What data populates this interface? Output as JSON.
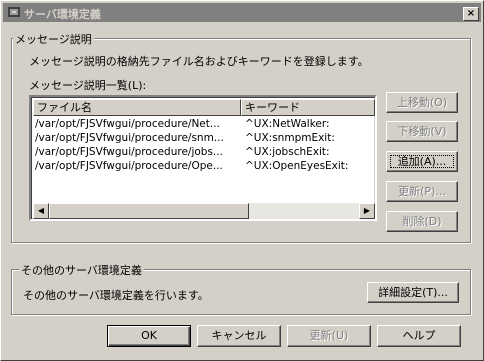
{
  "window": {
    "title": "サーバ環境定義",
    "close_glyph": "×"
  },
  "message_group": {
    "label": "メッセージ説明",
    "description": "メッセージ説明の格納先ファイル名およびキーワードを登録します。",
    "list_label": "メッセージ説明一覧(L):",
    "columns": [
      "ファイル名",
      "キーワード"
    ],
    "rows": [
      {
        "file": "/var/opt/FJSVfwgui/procedure/Net...",
        "keyword": "^UX:NetWalker:"
      },
      {
        "file": "/var/opt/FJSVfwgui/procedure/snm...",
        "keyword": "^UX:snmpmExit:"
      },
      {
        "file": "/var/opt/FJSVfwgui/procedure/jobs...",
        "keyword": "^UX:jobschExit:"
      },
      {
        "file": "/var/opt/FJSVfwgui/procedure/Ope...",
        "keyword": "^UX:OpenEyesExit:"
      }
    ],
    "buttons": {
      "up": "上移動(O)",
      "down": "下移動(V)",
      "add": "追加(A)...",
      "update": "更新(P)...",
      "delete": "削除(D)"
    },
    "scroll_left": "◀",
    "scroll_right": "▶"
  },
  "other_group": {
    "label": "その他のサーバ環境定義",
    "description": "その他のサーバ環境定義を行います。",
    "detail_button": "詳細設定(T)..."
  },
  "footer": {
    "ok": "OK",
    "cancel": "キャンセル",
    "update": "更新(U)",
    "help": "ヘルプ"
  }
}
